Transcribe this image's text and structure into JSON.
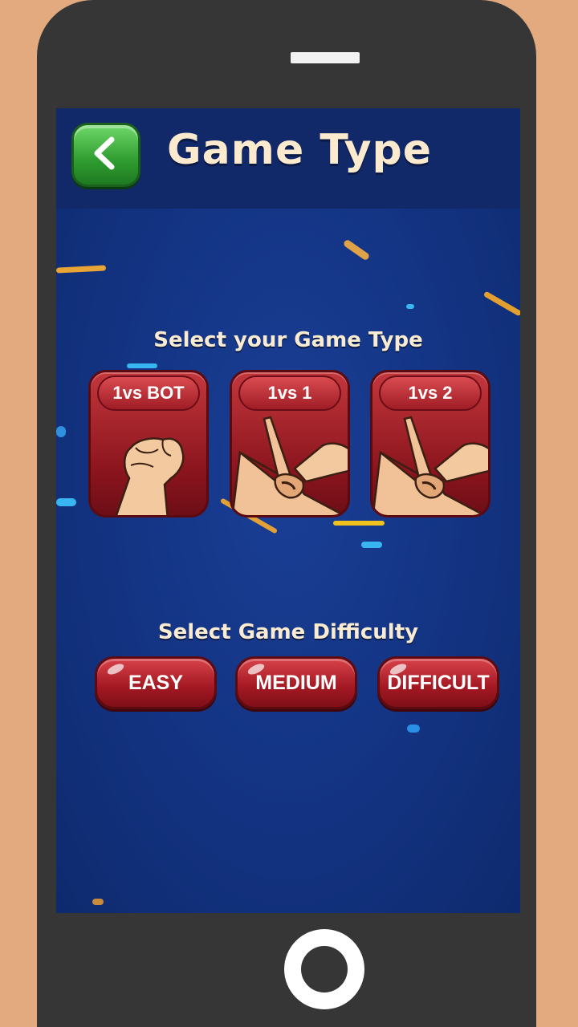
{
  "header": {
    "title": "Game Type",
    "back_icon": "chevron-left-icon"
  },
  "game_type": {
    "label": "Select your Game Type",
    "options": [
      {
        "label": "1vs BOT",
        "icon": "fist-hand-icon"
      },
      {
        "label": "1vs 1",
        "icon": "hands-clash-icon"
      },
      {
        "label": "1vs 2",
        "icon": "hands-clash-icon"
      }
    ]
  },
  "difficulty": {
    "label": "Select Game Difficulty",
    "options": [
      "EASY",
      "MEDIUM",
      "DIFFICULT"
    ]
  },
  "colors": {
    "background": "#133382",
    "header": "#112869",
    "button_red": "#a21822",
    "back_green": "#2f9c2f",
    "text_cream": "#f9ecd2",
    "device_frame": "#363636",
    "backdrop": "#e2aa7e"
  }
}
